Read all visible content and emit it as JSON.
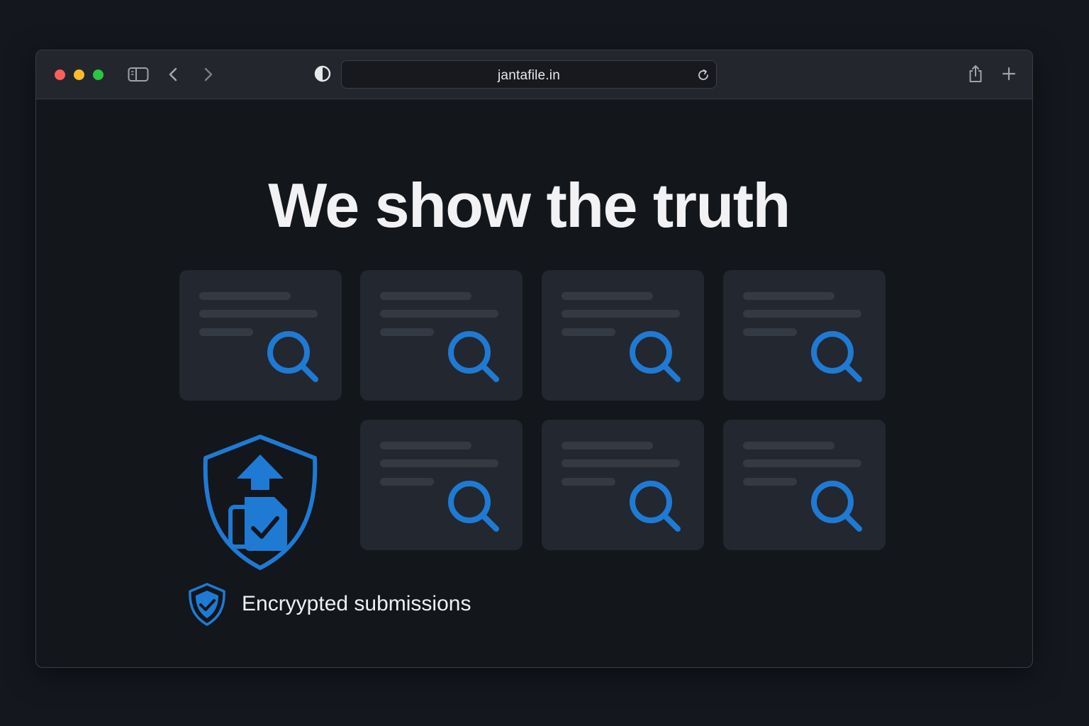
{
  "browser": {
    "url": "jantafile.in",
    "icons": [
      "sidebar-icon",
      "chevron-left-icon",
      "chevron-right-icon",
      "privacy-shield-icon",
      "reload-icon",
      "share-icon",
      "plus-icon"
    ]
  },
  "page": {
    "headline": "We show the truth",
    "document_cards": [
      {
        "icon": "magnifier-icon"
      },
      {
        "icon": "magnifier-icon"
      },
      {
        "icon": "magnifier-icon"
      },
      {
        "icon": "magnifier-icon"
      },
      {
        "icon": "magnifier-icon"
      },
      {
        "icon": "magnifier-icon"
      },
      {
        "icon": "magnifier-icon"
      }
    ],
    "feature": {
      "label": "Encryypted submissions",
      "icon": "shield-check-icon",
      "illustration": "shield-upload-document-icon"
    }
  },
  "colors": {
    "accent": "#1f7ad4",
    "background": "#13161b",
    "card": "#23272f",
    "traffic_red": "#fe5f57",
    "traffic_yellow": "#febc2e",
    "traffic_green": "#28c840"
  }
}
